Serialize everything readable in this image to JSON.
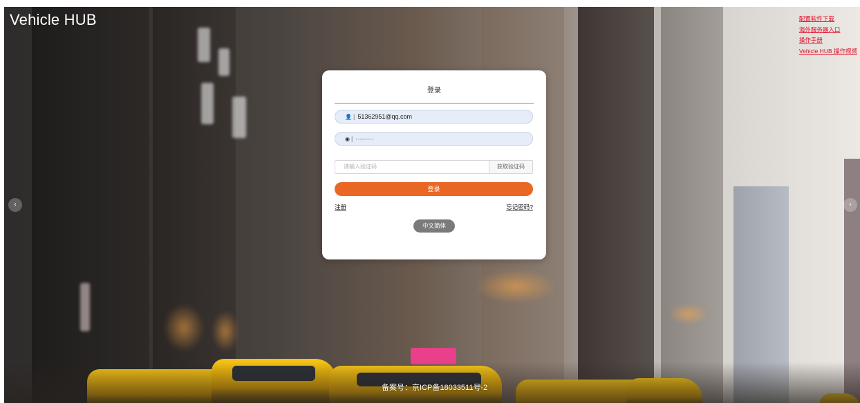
{
  "brand": "Vehicle HUB",
  "top_links": [
    "配置软件下载",
    "海外服务器入口",
    "操作手册",
    "Vehicle HUB 操作视频"
  ],
  "login": {
    "title": "登录",
    "username_value": "51362951@qq.com",
    "password_value": "·········",
    "captcha_placeholder": "请输入验证码",
    "get_code_label": "获取验证码",
    "login_button": "登录",
    "register_link": "注册",
    "forgot_link": "忘记密码?",
    "language_button": "中文简体"
  },
  "carousel": {
    "prev": "‹",
    "next": "›"
  },
  "footer": "备案号：京ICP备18033511号-2",
  "icons": {
    "user": "user-icon",
    "eye": "eye-icon"
  },
  "colors": {
    "accent": "#ea6624",
    "link": "#e0102a"
  }
}
